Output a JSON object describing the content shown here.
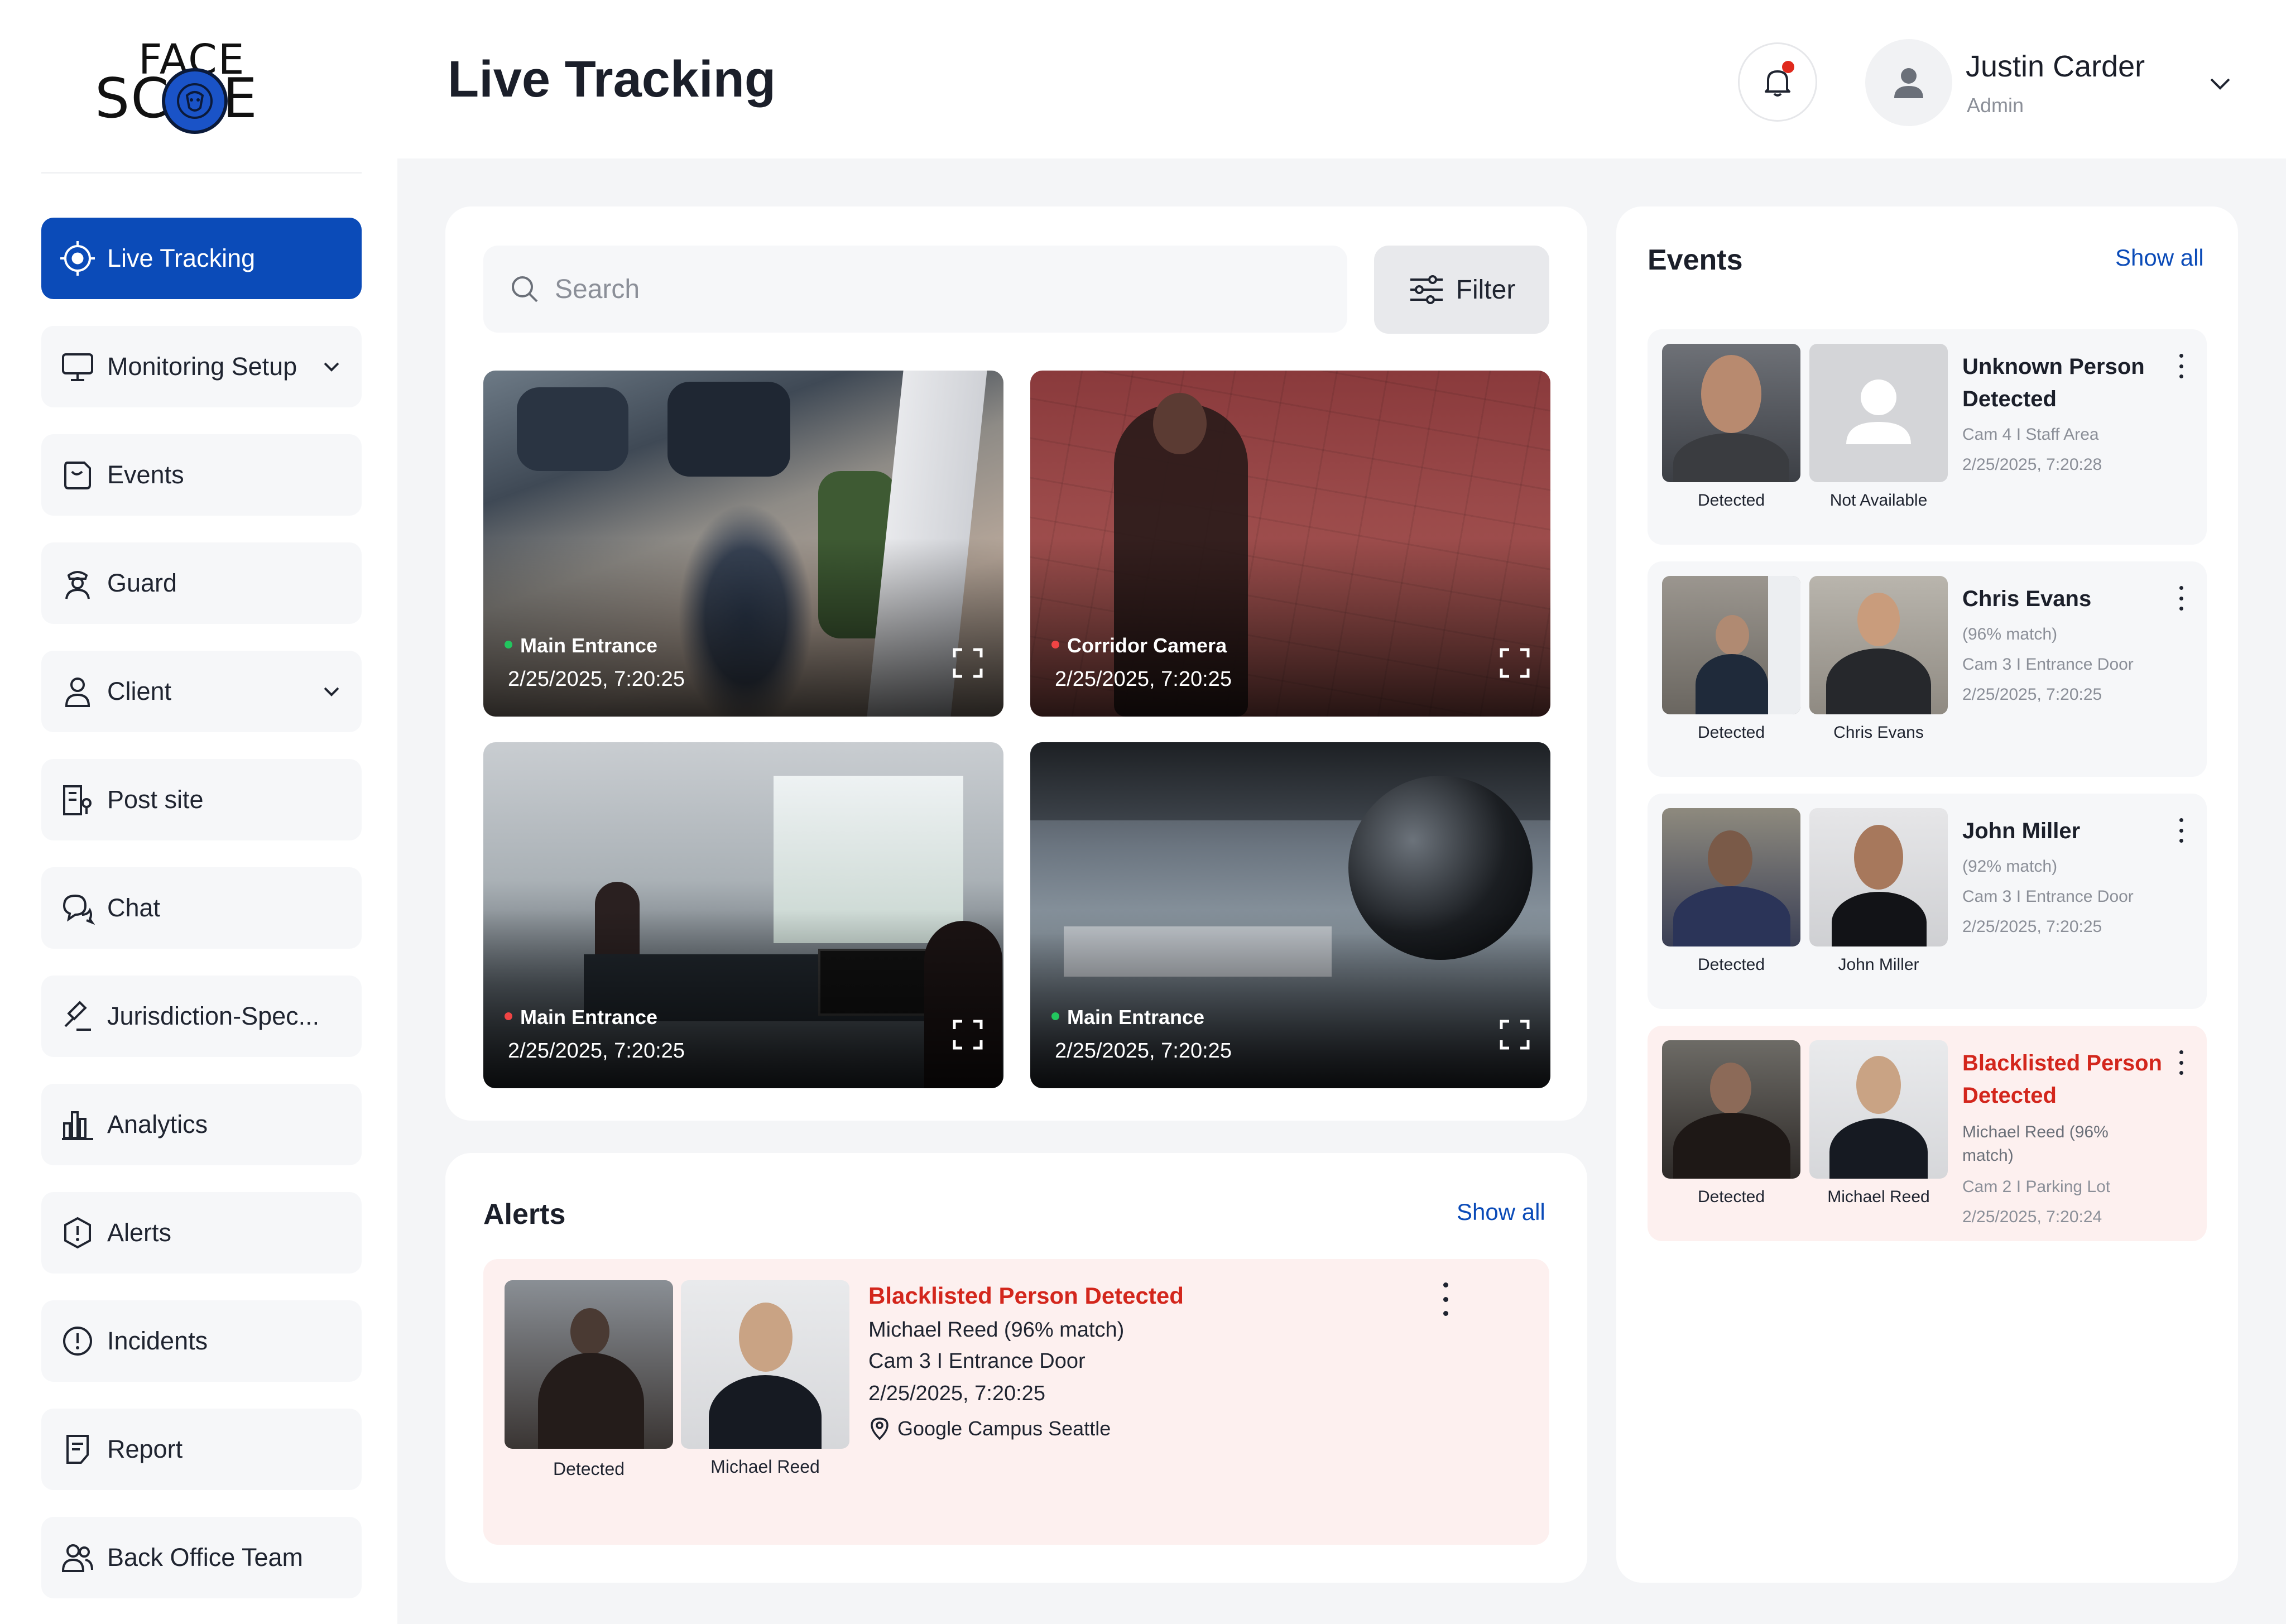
{
  "brand": {
    "logo_line1": "FACE",
    "logo_line2": "SC PE"
  },
  "sidebar": {
    "items": [
      {
        "label": "Live Tracking",
        "icon": "crosshair-icon",
        "active": true
      },
      {
        "label": "Monitoring Setup",
        "icon": "monitor-icon",
        "expandable": true
      },
      {
        "label": "Events",
        "icon": "events-icon"
      },
      {
        "label": "Guard",
        "icon": "guard-icon"
      },
      {
        "label": "Client",
        "icon": "user-icon",
        "expandable": true
      },
      {
        "label": "Post site",
        "icon": "building-icon"
      },
      {
        "label": "Chat",
        "icon": "chat-icon"
      },
      {
        "label": "Jurisdiction-Spec...",
        "icon": "gavel-icon"
      },
      {
        "label": "Analytics",
        "icon": "analytics-icon"
      },
      {
        "label": "Alerts",
        "icon": "alert-hexagon-icon"
      },
      {
        "label": "Incidents",
        "icon": "incident-icon"
      },
      {
        "label": "Report",
        "icon": "report-icon"
      },
      {
        "label": "Back Office Team",
        "icon": "team-icon"
      }
    ]
  },
  "header": {
    "title": "Live Tracking",
    "user": {
      "name": "Justin Carder",
      "role": "Admin"
    }
  },
  "toolbar": {
    "search_placeholder": "Search",
    "filter_label": "Filter"
  },
  "cameras": [
    {
      "name": "Main Entrance",
      "time": "2/25/2025, 7:20:25",
      "status_color": "#22c55e"
    },
    {
      "name": "Corridor Camera",
      "time": "2/25/2025, 7:20:25",
      "status_color": "#ef4444"
    },
    {
      "name": "Main Entrance",
      "time": "2/25/2025, 7:20:25",
      "status_color": "#ef4444"
    },
    {
      "name": "Main Entrance",
      "time": "2/25/2025, 7:20:25",
      "status_color": "#22c55e"
    }
  ],
  "alerts": {
    "title": "Alerts",
    "show_all": "Show all",
    "items": [
      {
        "title": "Blacklisted Person Detected",
        "person": "Michael Reed (96% match)",
        "camera": "Cam 3 I Entrance  Door",
        "time": "2/25/2025, 7:20:25",
        "location": "Google Campus Seattle",
        "label_detected": "Detected",
        "label_match": "Michael Reed"
      }
    ]
  },
  "events": {
    "title": "Events",
    "show_all": "Show all",
    "items": [
      {
        "title": "Unknown Person Detected",
        "match": "",
        "camera": "Cam 4 I Staff Area",
        "time": "2/25/2025, 7:20:28",
        "label_detected": "Detected",
        "label_match": "Not Available",
        "blacklisted": false
      },
      {
        "title": "Chris Evans",
        "match": "(96% match)",
        "camera": "Cam 3 I Entrance  Door",
        "time": "2/25/2025, 7:20:25",
        "label_detected": "Detected",
        "label_match": "Chris Evans",
        "blacklisted": false
      },
      {
        "title": "John Miller",
        "match": "(92% match)",
        "camera": "Cam 3 I Entrance  Door",
        "time": "2/25/2025, 7:20:25",
        "label_detected": "Detected",
        "label_match": "John Miller",
        "blacklisted": false
      },
      {
        "title": "Blacklisted Person Detected",
        "match": "Michael Reed (96% match)",
        "camera": "Cam 2 I Parking Lot",
        "time": "2/25/2025, 7:20:24",
        "label_detected": "Detected",
        "label_match": "Michael Reed",
        "blacklisted": true
      }
    ]
  },
  "colors": {
    "primary": "#0b4bb8",
    "danger": "#d3261c",
    "alert_bg": "#fdf0ef",
    "card_bg": "#f6f7f9",
    "page_bg": "#f4f5f7"
  }
}
